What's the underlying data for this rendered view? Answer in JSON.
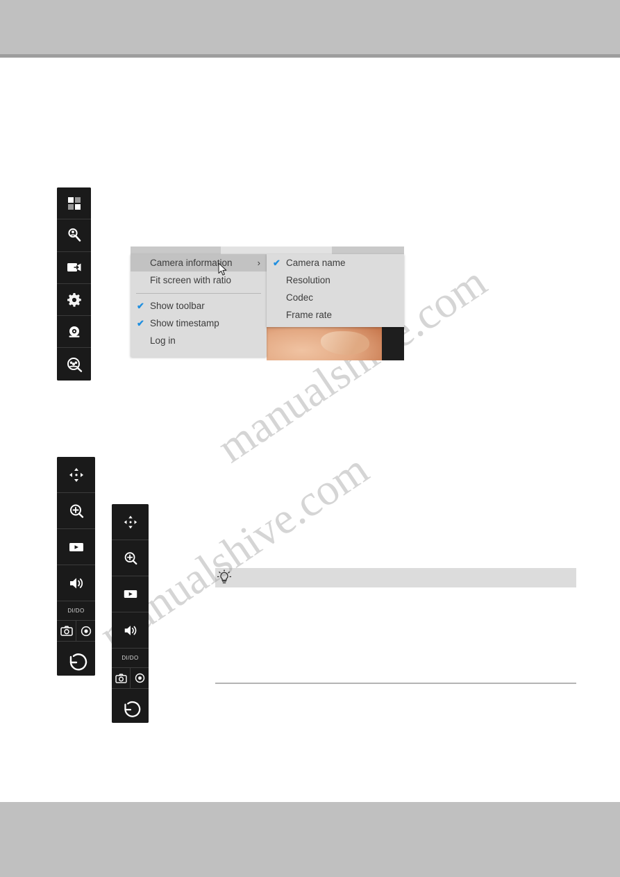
{
  "page": {
    "header_band_color": "#c0c0c0",
    "footer_band_color": "#c0c0c0",
    "accent_color": "#1f8fe0",
    "watermark_line_1": "manualshive.com",
    "watermark_line_2": "manualshive.com"
  },
  "context_menu": {
    "items": [
      {
        "label": "Camera information",
        "checked": false,
        "has_submenu": true,
        "highlighted": true
      },
      {
        "label": "Fit screen with ratio",
        "checked": false,
        "has_submenu": false,
        "highlighted": false
      },
      {
        "label": "Show toolbar",
        "checked": true,
        "has_submenu": false,
        "highlighted": false
      },
      {
        "label": "Show timestamp",
        "checked": true,
        "has_submenu": false,
        "highlighted": false
      },
      {
        "label": "Log in",
        "checked": false,
        "has_submenu": false,
        "highlighted": false
      }
    ],
    "submenu_arrow": "›",
    "check_glyph": "✔"
  },
  "context_submenu": {
    "items": [
      {
        "label": "Camera name",
        "checked": true
      },
      {
        "label": "Resolution",
        "checked": false
      },
      {
        "label": "Codec",
        "checked": false
      },
      {
        "label": "Frame rate",
        "checked": false
      }
    ]
  },
  "toolbar_main": {
    "items": [
      {
        "icon": "layout-grid-icon",
        "label": "Screen layout"
      },
      {
        "icon": "search-person-icon",
        "label": "Search"
      },
      {
        "icon": "export-video-icon",
        "label": "Export video"
      },
      {
        "icon": "gear-icon",
        "label": "Settings"
      },
      {
        "icon": "alarm-bell-icon",
        "label": "Alarm"
      },
      {
        "icon": "people-search-icon",
        "label": "People search"
      }
    ]
  },
  "toolbar_ptz_left": {
    "items": [
      {
        "icon": "pan-tilt-arrows-icon",
        "label": "Pan / Tilt"
      },
      {
        "icon": "zoom-in-icon",
        "label": "Zoom"
      },
      {
        "icon": "playback-icon",
        "label": "Playback"
      },
      {
        "icon": "speaker-icon",
        "label": "Audio"
      },
      {
        "icon": "dido-label-icon",
        "label": "DI/DO"
      },
      {
        "icon": "snapshot-icon",
        "label": "Snapshot"
      },
      {
        "icon": "record-icon",
        "label": "Record"
      },
      {
        "icon": "rotate-back-icon",
        "label": "Manual trigger"
      }
    ],
    "dido_text": "DI/DO"
  },
  "toolbar_ptz_right": {
    "items": [
      {
        "icon": "pan-tilt-arrows-icon",
        "label": "Pan / Tilt"
      },
      {
        "icon": "zoom-in-icon",
        "label": "Zoom"
      },
      {
        "icon": "playback-icon",
        "label": "Playback"
      },
      {
        "icon": "speaker-icon",
        "label": "Audio"
      },
      {
        "icon": "dido-label-icon",
        "label": "DI/DO"
      },
      {
        "icon": "snapshot-icon",
        "label": "Snapshot"
      },
      {
        "icon": "record-icon",
        "label": "Record"
      },
      {
        "icon": "rotate-back-icon",
        "label": "Manual trigger"
      }
    ],
    "dido_text": "DI/DO"
  },
  "tip": {
    "icon": "lightbulb-icon",
    "text": ""
  }
}
